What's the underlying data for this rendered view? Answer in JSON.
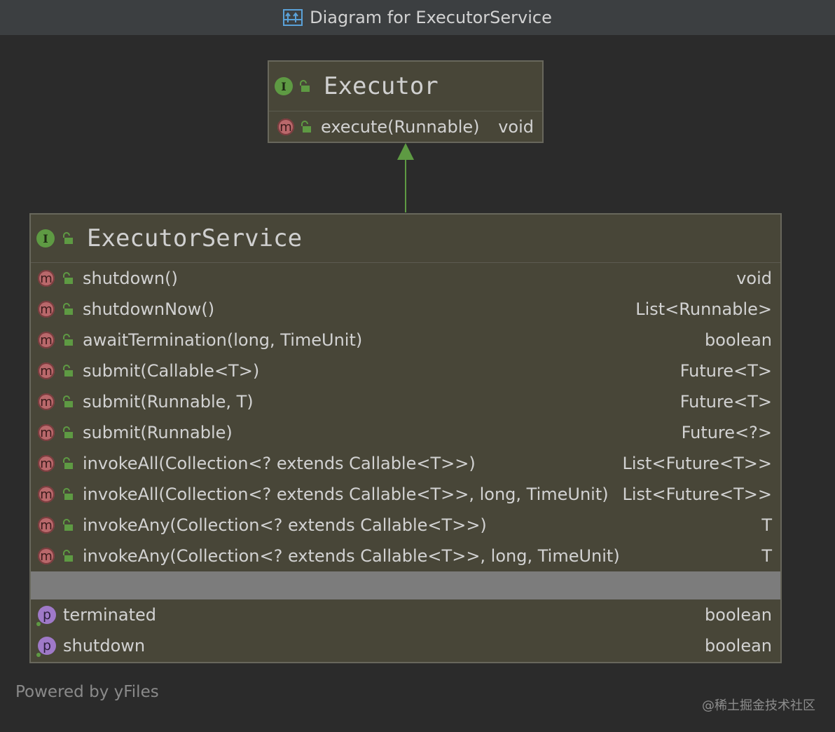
{
  "window": {
    "title": "Diagram for ExecutorService",
    "title_icon": "diagram-icon"
  },
  "executor": {
    "name": "Executor",
    "badge": "I",
    "methods": [
      {
        "name": "execute(Runnable)",
        "type": "void",
        "badge": "m"
      }
    ]
  },
  "executor_service": {
    "name": "ExecutorService",
    "badge": "I",
    "methods": [
      {
        "name": "shutdown()",
        "type": "void",
        "badge": "m"
      },
      {
        "name": "shutdownNow()",
        "type": "List<Runnable>",
        "badge": "m"
      },
      {
        "name": "awaitTermination(long, TimeUnit)",
        "type": "boolean",
        "badge": "m"
      },
      {
        "name": "submit(Callable<T>)",
        "type": "Future<T>",
        "badge": "m"
      },
      {
        "name": "submit(Runnable, T)",
        "type": "Future<T>",
        "badge": "m"
      },
      {
        "name": "submit(Runnable)",
        "type": "Future<?>",
        "badge": "m"
      },
      {
        "name": "invokeAll(Collection<? extends Callable<T>>)",
        "type": "List<Future<T>>",
        "badge": "m"
      },
      {
        "name": "invokeAll(Collection<? extends Callable<T>>, long, TimeUnit)",
        "type": "List<Future<T>>",
        "badge": "m"
      },
      {
        "name": "invokeAny(Collection<? extends Callable<T>>)",
        "type": "T",
        "badge": "m"
      },
      {
        "name": "invokeAny(Collection<? extends Callable<T>>, long, TimeUnit)",
        "type": "T",
        "badge": "m"
      }
    ],
    "properties": [
      {
        "name": "terminated",
        "type": "boolean",
        "badge": "p"
      },
      {
        "name": "shutdown",
        "type": "boolean",
        "badge": "p"
      }
    ]
  },
  "footer": {
    "powered_by": "Powered by yFiles",
    "watermark": "@稀土掘金技术社区"
  },
  "colors": {
    "background": "#2b2b2b",
    "class_fill": "#484638",
    "interface_badge": "#5e9a43",
    "method_badge": "#b9686b",
    "property_badge": "#9f79c8",
    "inheritance_arrow": "#5e9a43"
  }
}
